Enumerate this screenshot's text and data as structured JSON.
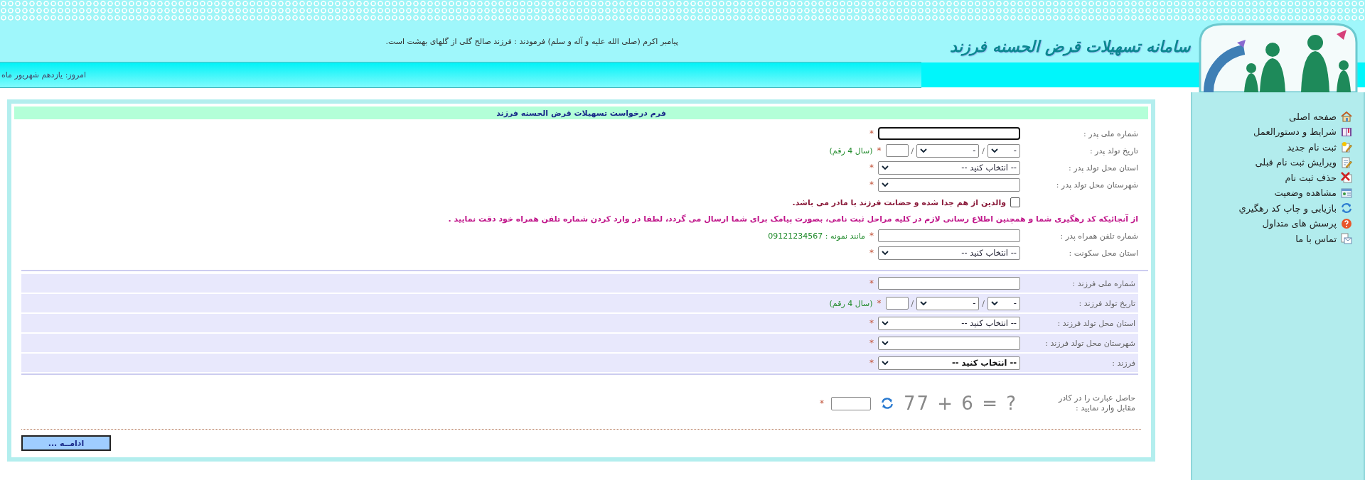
{
  "header": {
    "logo_title": "سامانه تسهیلات قرض الحسنه فرزند",
    "quote": "پیامبر اکرم (صلی الله علیه و آله و سلم) فرمودند : فرزند صالح گلی از گلهای بهشت است.",
    "date": "امروز: یازدهم شهریور ماه"
  },
  "sidebar": {
    "items": [
      {
        "label": "صفحه اصلی",
        "kind": "home"
      },
      {
        "label": "شرایط و دستورالعمل",
        "kind": "book"
      },
      {
        "label": "ثبت نام جدید",
        "kind": "new"
      },
      {
        "label": "ویرایش ثبت نام قبلی",
        "kind": "edit"
      },
      {
        "label": "حذف ثبت نام",
        "kind": "delete"
      },
      {
        "label": "مشاهده وضعیت",
        "kind": "status"
      },
      {
        "label": "بازیابی و چاپ کد رهگیري",
        "kind": "refresh"
      },
      {
        "label": "پرسش های متداول",
        "kind": "help"
      },
      {
        "label": "تماس با ما",
        "kind": "mail"
      }
    ]
  },
  "form": {
    "title": "فرم درخواست تسهیلات قرض الحسنه فرزند",
    "father_fields": [
      {
        "kind": "text",
        "label": "شماره ملی پدر :",
        "required_mark": "*",
        "focused": true
      },
      {
        "kind": "date",
        "label": "تاریخ تولد پدر :",
        "day": "-",
        "month": "-",
        "separators": [
          "/",
          "/"
        ],
        "required_mark": "*",
        "hint": "(سال 4 رقم)"
      },
      {
        "kind": "select",
        "label": "استان محل تولد پدر :",
        "value": "-- انتخاب کنید --",
        "emphasized": false,
        "required_mark": "*"
      },
      {
        "kind": "select",
        "label": "شهرستان محل تولد پدر :",
        "required_mark": "*"
      }
    ],
    "separated_parents": {
      "label": "والدین از هم جدا شده و حضانت فرزند با مادر می باشد.",
      "checked": false
    },
    "notice": "از آنجائیکه کد رهگیری شما و همچنین اطلاع رسانی لازم در کلیه مراحل ثبت نامی، بصورت پیامک برای شما ارسال می گردد، لطفا در وارد کردن شماره تلفن همراه خود دقت نمایید .",
    "contact_fields": [
      {
        "kind": "text",
        "label": "شماره تلفن همراه پدر :",
        "required_mark": "*",
        "focused": false,
        "hint": "مانند نمونه : 09121234567"
      },
      {
        "kind": "select",
        "label": "استان محل سکونت :",
        "value": "-- انتخاب کنید --",
        "emphasized": false,
        "required_mark": "*"
      }
    ],
    "child_fields": [
      {
        "kind": "text",
        "label": "شماره ملی فرزند :",
        "required_mark": "*",
        "focused": false
      },
      {
        "kind": "date",
        "label": "تاریخ تولد فرزند :",
        "day": "-",
        "month": "-",
        "separators": [
          "/",
          "/"
        ],
        "required_mark": "*",
        "hint": "(سال 4 رقم)"
      },
      {
        "kind": "select",
        "label": "استان محل تولد فرزند :",
        "value": "-- انتخاب کنید --",
        "emphasized": false,
        "required_mark": "*"
      },
      {
        "kind": "select",
        "label": "شهرستان محل تولد فرزند :",
        "required_mark": "*"
      },
      {
        "kind": "select",
        "label": "فرزند :",
        "value": "-- انتخاب کنید --",
        "emphasized": true,
        "required_mark": "*"
      }
    ],
    "captcha": {
      "label_lines": [
        "حاصل عبارت را در کادر",
        "مقابل وارد نمایید :"
      ],
      "expression": "77 + 6 = ?",
      "required_mark": "*"
    },
    "submit": "ادامــه ..."
  }
}
